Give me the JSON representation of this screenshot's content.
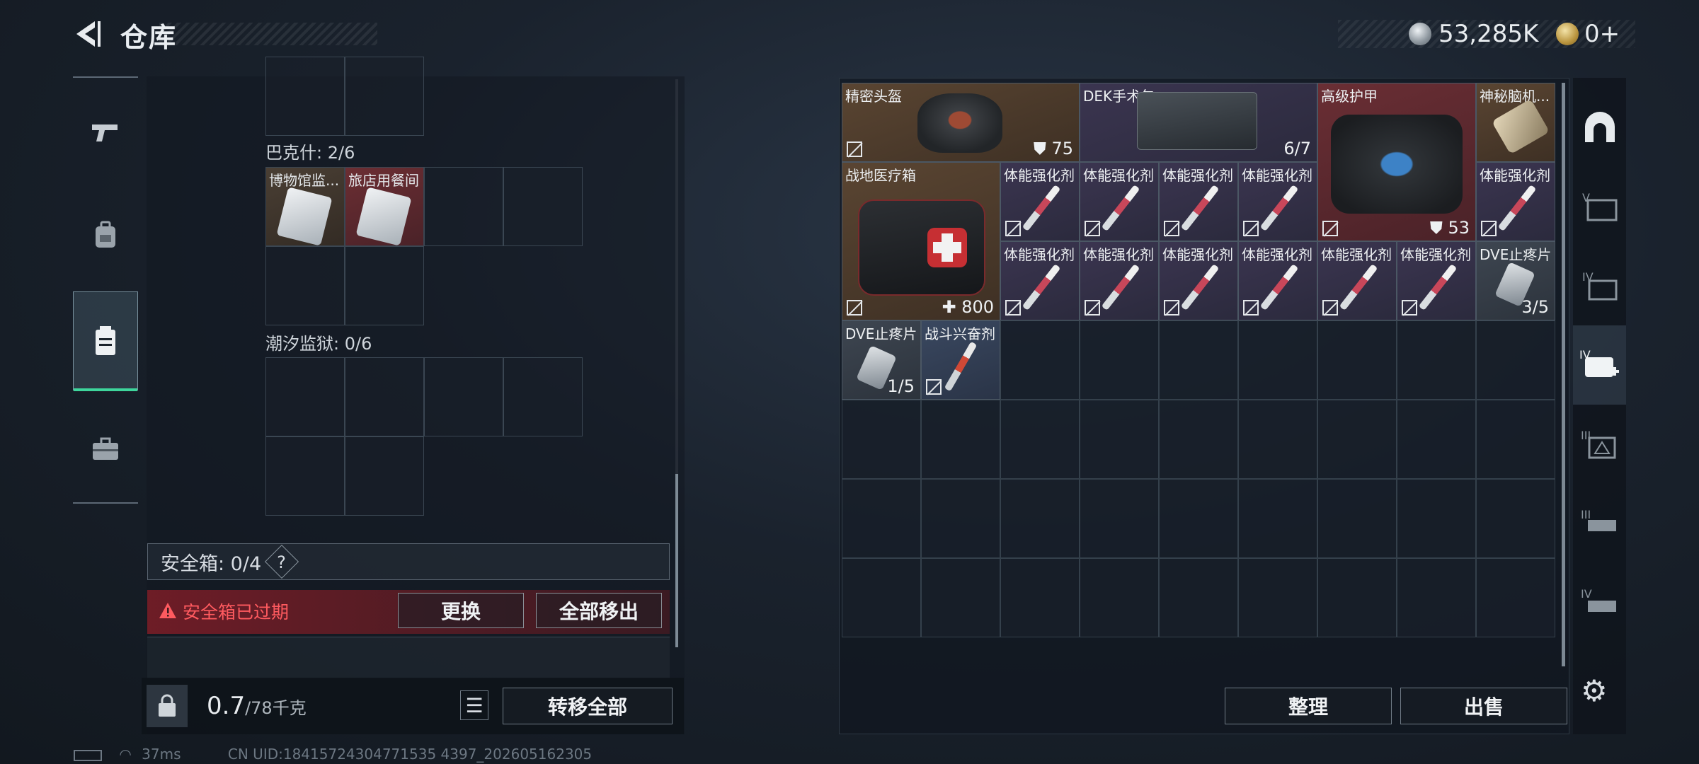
{
  "header": {
    "title": "仓库",
    "currency_silver": "53,285K",
    "currency_gold": "0+"
  },
  "left_nav": {
    "items": [
      {
        "icon": "pistol-icon"
      },
      {
        "icon": "backpack-icon"
      },
      {
        "icon": "chest-rig-icon",
        "active": true
      },
      {
        "icon": "briefcase-icon"
      }
    ]
  },
  "left_panel": {
    "sections": [
      {
        "label": "巴克什: 2/6"
      },
      {
        "label": "潮汐监狱: 0/6"
      }
    ],
    "bakshi_items": [
      {
        "name": "博物馆监..."
      },
      {
        "name": "旅店用餐间"
      }
    ],
    "safe_box_label": "安全箱: 0/4",
    "safe_box_help": "?",
    "expired_warning": "安全箱已过期",
    "replace_button": "更换",
    "move_all_out_button": "全部移出",
    "weight_value": "0.7",
    "weight_max": "/78千克",
    "transfer_all_button": "转移全部"
  },
  "storage": {
    "items": [
      {
        "name": "精密头盔",
        "value": "75",
        "value_icon": "shield"
      },
      {
        "name": "DEK手术包",
        "value": "6/7"
      },
      {
        "name": "高级护甲",
        "value": "53",
        "value_icon": "shield"
      },
      {
        "name": "神秘脑机..."
      },
      {
        "name": "战地医疗箱",
        "value": "800",
        "value_icon": "plus"
      },
      {
        "name": "体能强化剂"
      },
      {
        "name": "DVE止疼片",
        "value": "3/5"
      },
      {
        "name": "DVE止疼片",
        "value": "1/5"
      },
      {
        "name": "战斗兴奋剂"
      }
    ],
    "sort_button": "整理",
    "sell_button": "出售"
  },
  "status_bar": {
    "ping": "37ms",
    "uid": "CN UID:18415724304771535 4397_202605162305"
  }
}
